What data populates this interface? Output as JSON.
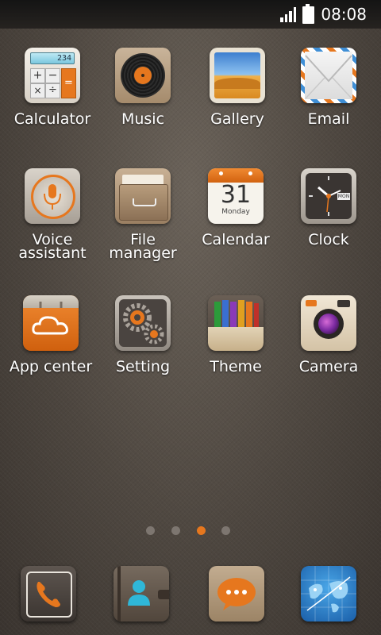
{
  "status_bar": {
    "time": "08:08",
    "icons": [
      "signal-icon",
      "battery-icon"
    ]
  },
  "apps": [
    {
      "name": "calculator",
      "label": "Calculator",
      "icon": "calculator-icon",
      "display_value": "234"
    },
    {
      "name": "music",
      "label": "Music",
      "icon": "vinyl-record-icon"
    },
    {
      "name": "gallery",
      "label": "Gallery",
      "icon": "photo-desert-icon"
    },
    {
      "name": "email",
      "label": "Email",
      "icon": "envelope-icon"
    },
    {
      "name": "voice-assistant",
      "label": [
        "Voice",
        "assistant"
      ],
      "icon": "microphone-icon"
    },
    {
      "name": "file-manager",
      "label": [
        "File",
        "manager"
      ],
      "icon": "drawer-icon"
    },
    {
      "name": "calendar",
      "label": "Calendar",
      "icon": "calendar-icon",
      "day_number": "31",
      "weekday": "Monday"
    },
    {
      "name": "clock",
      "label": "Clock",
      "icon": "clock-icon",
      "badge": "MON"
    },
    {
      "name": "app-center",
      "label": "App center",
      "icon": "cloud-bag-icon"
    },
    {
      "name": "setting",
      "label": "Setting",
      "icon": "gears-icon"
    },
    {
      "name": "theme",
      "label": "Theme",
      "icon": "pencils-icon"
    },
    {
      "name": "camera",
      "label": "Camera",
      "icon": "camera-icon"
    }
  ],
  "page_indicator": {
    "count": 4,
    "active_index": 2
  },
  "dock": [
    {
      "name": "phone",
      "icon": "phone-handset-icon"
    },
    {
      "name": "contacts",
      "icon": "contacts-book-icon"
    },
    {
      "name": "messaging",
      "icon": "chat-bubble-icon"
    },
    {
      "name": "browser",
      "icon": "globe-map-icon"
    }
  ],
  "colors": {
    "accent": "#e6771e",
    "wallpaper": "#4e4740",
    "status_bar": "#1c1a18"
  }
}
